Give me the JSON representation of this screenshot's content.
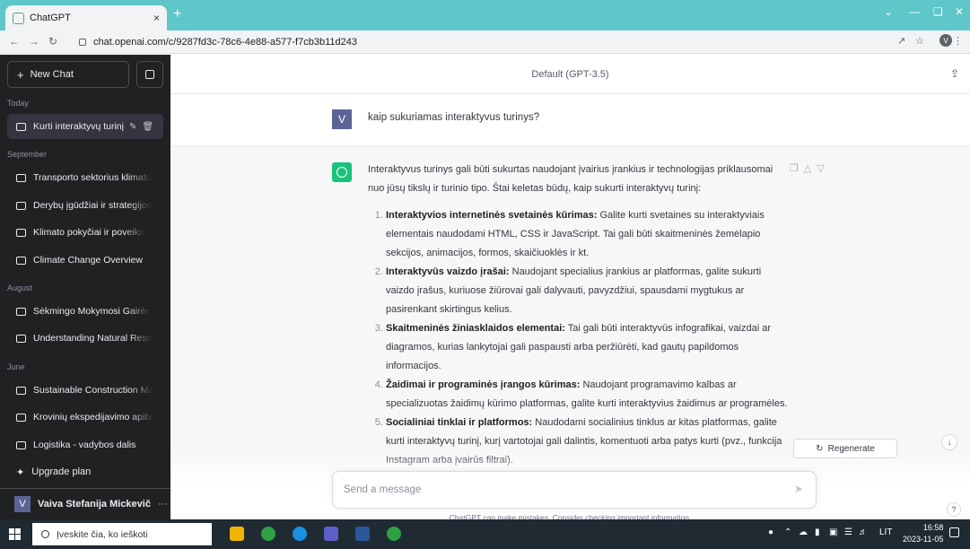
{
  "browser": {
    "tab_title": "ChatGPT",
    "tab_close": "×",
    "new_tab": "+",
    "url": "chat.openai.com/c/9287fd3c-78c6-4e88-a577-f7cb3b11d243",
    "profile_initial": "V"
  },
  "sidebar": {
    "new_chat_label": "New Chat",
    "sections": [
      {
        "label": "Today"
      },
      {
        "label": "September"
      },
      {
        "label": "August"
      },
      {
        "label": "June"
      }
    ],
    "items": [
      {
        "label": "Kurti interaktyvų turinį"
      },
      {
        "label": "Transporto sektorius klimato"
      },
      {
        "label": "Derybų įgūdžiai ir strategijos"
      },
      {
        "label": "Klimato pokyčiai ir poveikis"
      },
      {
        "label": "Climate Change Overview"
      },
      {
        "label": "Sėkmingo Mokymosi Gairės"
      },
      {
        "label": "Understanding Natural Reso"
      },
      {
        "label": "Sustainable Construction Ma"
      },
      {
        "label": "Krovinių ekspedijavimo apibr"
      },
      {
        "label": "Logistika - vadybos dalis"
      }
    ],
    "upgrade_label": "Upgrade plan",
    "user_initial": "V",
    "user_name": "Vaiva Stefanija Mickevič",
    "user_more": "···"
  },
  "main": {
    "model_label": "Default (GPT-3.5)",
    "user_initial": "V",
    "user_message": "kaip sukuriamas interaktyvus turinys?",
    "response_intro": "Interaktyvus turinys gali būti sukurtas naudojant įvairius įrankius ir technologijas priklausomai nuo jūsų tikslų ir turinio tipo. Štai keletas būdų, kaip sukurti interaktyvų turinį:",
    "response_items": [
      {
        "title": "Interaktyvios internetinės svetainės kūrimas:",
        "text": " Galite kurti svetaines su interaktyviais elementais naudodami HTML, CSS ir JavaScript. Tai gali būti skaitmeninės žemėlapio sekcijos, animacijos, formos, skaičiuoklės ir kt."
      },
      {
        "title": "Interaktyvūs vaizdo įrašai:",
        "text": " Naudojant specialius įrankius ar platformas, galite sukurti vaizdo įrašus, kuriuose žiūrovai gali dalyvauti, pavyzdžiui, spausdami mygtukus ar pasirenkant skirtingus kelius."
      },
      {
        "title": "Skaitmeninės žiniasklaidos elementai:",
        "text": " Tai gali būti interaktyvūs infografikai, vaizdai ar diagramos, kurias lankytojai gali paspausti arba peržiūrėti, kad gautų papildomos informacijos."
      },
      {
        "title": "Žaidimai ir programinės įrangos kūrimas:",
        "text": " Naudojant programavimo kalbas ar specializuotas žaidimų kūrimo platformas, galite kurti interaktyvius žaidimus ar programėles."
      },
      {
        "title": "Socialiniai tinklai ir platformos:",
        "text": " Naudodami socialinius tinklus ar kitas platformas, galite kurti interaktyvų turinį, kurį vartotojai gali dalintis, komentuoti arba patys kurti (pvz., funkcija Instagram arba įvairūs filtrai)."
      }
    ],
    "regenerate_label": "Regenerate",
    "input_placeholder": "Send a message",
    "disclaimer": "ChatGPT can make mistakes. Consider checking important information.",
    "help": "?"
  },
  "taskbar": {
    "search_placeholder": "Įveskite čia, ko ieškoti",
    "lang": "LIT",
    "time": "16:58",
    "date": "2023-11-05"
  }
}
